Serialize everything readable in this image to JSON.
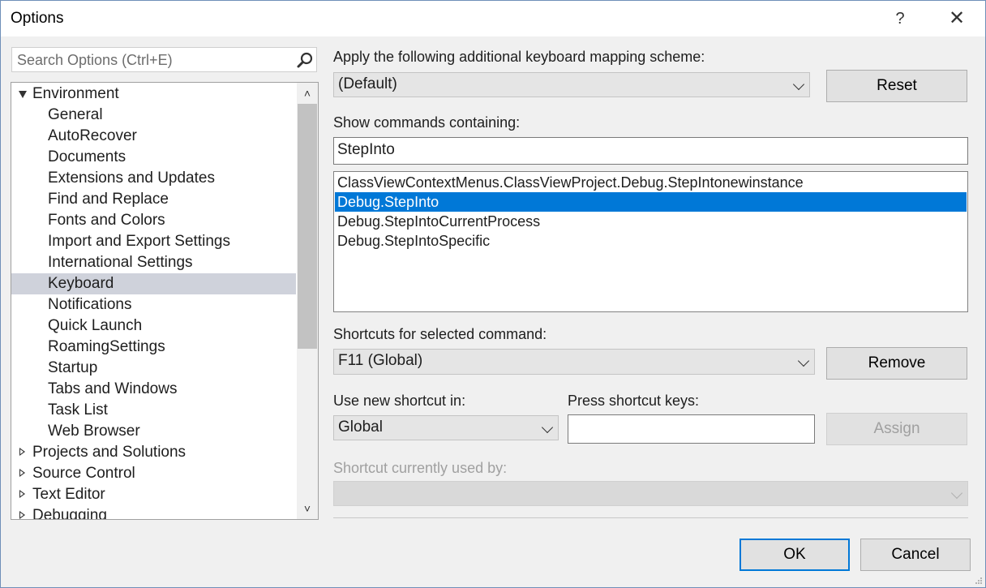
{
  "window": {
    "title": "Options",
    "help_label": "?",
    "close_label": "✕"
  },
  "search": {
    "placeholder": "Search Options (Ctrl+E)",
    "icon": "search-icon"
  },
  "tree": {
    "items": [
      {
        "label": "Environment",
        "level": 0,
        "expander": "expanded"
      },
      {
        "label": "General",
        "level": 1
      },
      {
        "label": "AutoRecover",
        "level": 1
      },
      {
        "label": "Documents",
        "level": 1
      },
      {
        "label": "Extensions and Updates",
        "level": 1
      },
      {
        "label": "Find and Replace",
        "level": 1
      },
      {
        "label": "Fonts and Colors",
        "level": 1
      },
      {
        "label": "Import and Export Settings",
        "level": 1
      },
      {
        "label": "International Settings",
        "level": 1
      },
      {
        "label": "Keyboard",
        "level": 1,
        "selected": true
      },
      {
        "label": "Notifications",
        "level": 1
      },
      {
        "label": "Quick Launch",
        "level": 1
      },
      {
        "label": "RoamingSettings",
        "level": 1
      },
      {
        "label": "Startup",
        "level": 1
      },
      {
        "label": "Tabs and Windows",
        "level": 1
      },
      {
        "label": "Task List",
        "level": 1
      },
      {
        "label": "Web Browser",
        "level": 1
      },
      {
        "label": "Projects and Solutions",
        "level": 0,
        "expander": "collapsed"
      },
      {
        "label": "Source Control",
        "level": 0,
        "expander": "collapsed"
      },
      {
        "label": "Text Editor",
        "level": 0,
        "expander": "collapsed"
      },
      {
        "label": "Debugging",
        "level": 0,
        "expander": "collapsed"
      }
    ]
  },
  "mapping": {
    "label": "Apply the following additional keyboard mapping scheme:",
    "value": "(Default)",
    "reset_label": "Reset"
  },
  "commands": {
    "label": "Show commands containing:",
    "filter_value": "StepInto",
    "items": [
      "ClassViewContextMenus.ClassViewProject.Debug.StepIntonewinstance",
      "Debug.StepInto",
      "Debug.StepIntoCurrentProcess",
      "Debug.StepIntoSpecific"
    ],
    "selected_index": 1
  },
  "shortcuts": {
    "label": "Shortcuts for selected command:",
    "value": "F11 (Global)",
    "remove_label": "Remove"
  },
  "new_shortcut": {
    "scope_label": "Use new shortcut in:",
    "scope_value": "Global",
    "keys_label": "Press shortcut keys:",
    "keys_value": "",
    "assign_label": "Assign"
  },
  "used_by": {
    "label": "Shortcut currently used by:",
    "value": ""
  },
  "footer": {
    "ok_label": "OK",
    "cancel_label": "Cancel"
  },
  "colors": {
    "accent": "#0078d7",
    "tree_selected": "#cfd2db",
    "disabled_text": "#a0a0a0"
  }
}
